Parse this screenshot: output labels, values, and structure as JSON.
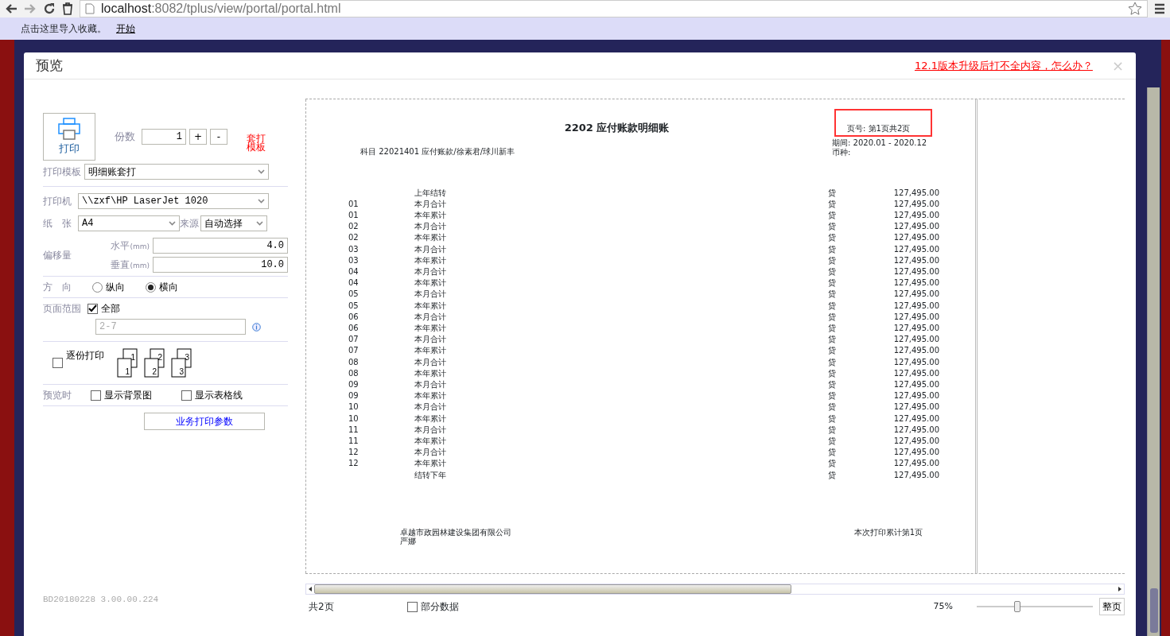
{
  "browser": {
    "url_host": "localhost",
    "url_path": ":8082/tplus/view/portal/portal.html"
  },
  "bookmarks_bar": {
    "hint": "点击这里导入收藏。",
    "link": "开始"
  },
  "dialog": {
    "title": "预览",
    "help_link": "12.1版本升级后打不全内容，怎么办？",
    "close": "×"
  },
  "settings": {
    "print_button": "打印",
    "copies_label": "份数",
    "copies": "1",
    "plus": "+",
    "minus": "-",
    "template_note": [
      "套打",
      "模板"
    ],
    "template_label": "打印模板",
    "template": "明细账套打",
    "printer_label": "打印机",
    "printer": "\\\\zxf\\HP LaserJet 1020",
    "paper_label": "纸　张",
    "paper": "A4",
    "source_label": "来源",
    "source": "自动选择",
    "offset_label": "偏移量",
    "horizontal_label": "水平",
    "horizontal_unit": "(mm)",
    "horizontal": "4.0",
    "vertical_label": "垂直",
    "vertical_unit": "(mm)",
    "vertical": "10.0",
    "orientation_label": "方　向",
    "orientations": [
      {
        "label": "纵向",
        "selected": false
      },
      {
        "label": "横向",
        "selected": true
      }
    ],
    "range_label": "页面范围",
    "all_pages": {
      "label": "全部",
      "checked": true
    },
    "range": "2-7",
    "collate": {
      "label": "逐份打印",
      "checked": false
    },
    "collate_stacks": [
      {
        "back": "1",
        "front": "1"
      },
      {
        "back": "2",
        "front": "2"
      },
      {
        "back": "3",
        "front": "3"
      }
    ],
    "preview_label": "预览时",
    "preview_options": [
      {
        "label": "显示背景图",
        "checked": false
      },
      {
        "label": "显示表格线",
        "checked": false
      }
    ],
    "business_button": "业务打印参数",
    "version": "BD20180228 3.00.00.224"
  },
  "report": {
    "title": "2202 应付账款明细账",
    "subject": "科目 22021401 应付账款/徐素君/球川新丰",
    "page_no_label": "页号:",
    "page_no": "第1页共2页",
    "page_no_highlighted": true,
    "period": "期间:  2020.01 - 2020.12",
    "currency": "币种:",
    "rows": [
      {
        "period": "",
        "summary": "上年结转",
        "direction": "贷",
        "balance": "127,495.00"
      },
      {
        "period": "01",
        "summary": "本月合计",
        "direction": "贷",
        "balance": "127,495.00"
      },
      {
        "period": "01",
        "summary": "本年累计",
        "direction": "贷",
        "balance": "127,495.00"
      },
      {
        "period": "02",
        "summary": "本月合计",
        "direction": "贷",
        "balance": "127,495.00"
      },
      {
        "period": "02",
        "summary": "本年累计",
        "direction": "贷",
        "balance": "127,495.00"
      },
      {
        "period": "03",
        "summary": "本月合计",
        "direction": "贷",
        "balance": "127,495.00"
      },
      {
        "period": "03",
        "summary": "本年累计",
        "direction": "贷",
        "balance": "127,495.00"
      },
      {
        "period": "04",
        "summary": "本月合计",
        "direction": "贷",
        "balance": "127,495.00"
      },
      {
        "period": "04",
        "summary": "本年累计",
        "direction": "贷",
        "balance": "127,495.00"
      },
      {
        "period": "05",
        "summary": "本月合计",
        "direction": "贷",
        "balance": "127,495.00"
      },
      {
        "period": "05",
        "summary": "本年累计",
        "direction": "贷",
        "balance": "127,495.00"
      },
      {
        "period": "06",
        "summary": "本月合计",
        "direction": "贷",
        "balance": "127,495.00"
      },
      {
        "period": "06",
        "summary": "本年累计",
        "direction": "贷",
        "balance": "127,495.00"
      },
      {
        "period": "07",
        "summary": "本月合计",
        "direction": "贷",
        "balance": "127,495.00"
      },
      {
        "period": "07",
        "summary": "本年累计",
        "direction": "贷",
        "balance": "127,495.00"
      },
      {
        "period": "08",
        "summary": "本月合计",
        "direction": "贷",
        "balance": "127,495.00"
      },
      {
        "period": "08",
        "summary": "本年累计",
        "direction": "贷",
        "balance": "127,495.00"
      },
      {
        "period": "09",
        "summary": "本月合计",
        "direction": "贷",
        "balance": "127,495.00"
      },
      {
        "period": "09",
        "summary": "本年累计",
        "direction": "贷",
        "balance": "127,495.00"
      },
      {
        "period": "10",
        "summary": "本月合计",
        "direction": "贷",
        "balance": "127,495.00"
      },
      {
        "period": "10",
        "summary": "本年累计",
        "direction": "贷",
        "balance": "127,495.00"
      },
      {
        "period": "11",
        "summary": "本月合计",
        "direction": "贷",
        "balance": "127,495.00"
      },
      {
        "period": "11",
        "summary": "本年累计",
        "direction": "贷",
        "balance": "127,495.00"
      },
      {
        "period": "12",
        "summary": "本月合计",
        "direction": "贷",
        "balance": "127,495.00"
      },
      {
        "period": "12",
        "summary": "本年累计",
        "direction": "贷",
        "balance": "127,495.00"
      },
      {
        "period": "",
        "summary": "结转下年",
        "direction": "贷",
        "balance": "127,495.00"
      }
    ],
    "footer_company": "卓越市政园林建设集团有限公司",
    "footer_person": "严娜",
    "footer_count": "本次打印累计第1页"
  },
  "status": {
    "total": "共2页",
    "partial_data": {
      "label": "部分数据",
      "checked": false
    },
    "zoom": "75%",
    "zoom_slider": {
      "level": 0.35
    },
    "fit_button": "整页"
  }
}
